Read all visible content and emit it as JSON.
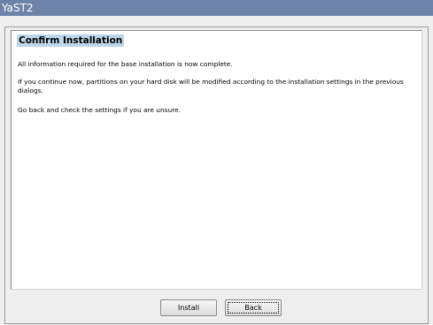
{
  "window": {
    "title": "YaST2"
  },
  "dialog": {
    "heading": "Confirm Installation",
    "paragraphs": [
      "All information required for the base installation is now complete.",
      "If you continue now, partitions on your hard disk will be modified according to the installation settings in the previous dialogs.",
      "Go back and check the settings if you are unsure."
    ]
  },
  "buttons": {
    "install": "Install",
    "back": "Back"
  }
}
